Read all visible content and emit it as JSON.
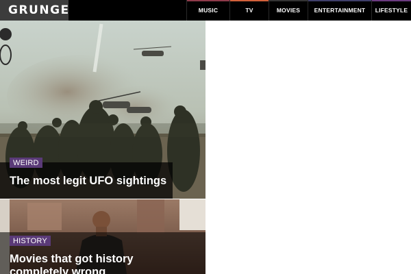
{
  "header": {
    "logo_text": "GRUNGE",
    "nav": [
      {
        "label": "MUSIC"
      },
      {
        "label": "TV"
      },
      {
        "label": "MOVIES"
      },
      {
        "label": "ENTERTAINMENT"
      },
      {
        "label": "LIFESTYLE"
      }
    ]
  },
  "articles": [
    {
      "tag": "WEIRD",
      "title": "The most legit UFO sightings"
    },
    {
      "tag": "HISTORY",
      "title": "Movies that got history completely wrong"
    }
  ],
  "colors": {
    "header_bg": "#000000",
    "logo_bg": "#3c3c3c",
    "tag_bg": "#5a3a78",
    "nav_accents": [
      "#8e3a4a",
      "#d1603a",
      "#333333",
      "#3f3f6a",
      "#6b3a80"
    ]
  }
}
